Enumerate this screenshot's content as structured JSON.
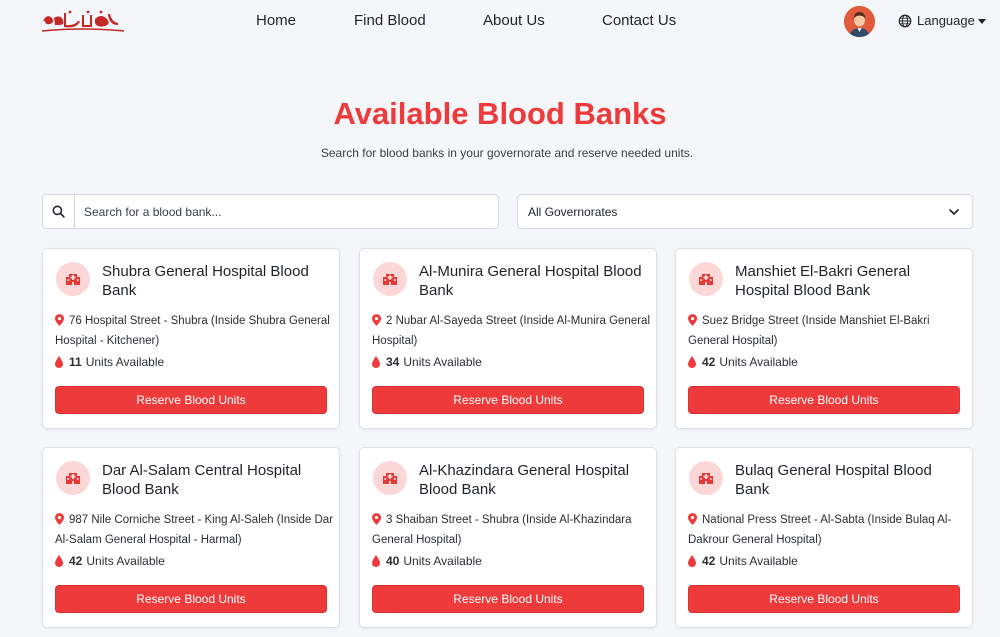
{
  "nav": {
    "links": [
      "Home",
      "Find Blood",
      "About Us",
      "Contact Us"
    ],
    "language_label": "Language"
  },
  "header": {
    "title": "Available Blood Banks",
    "subtitle": "Search for blood banks in your governorate and reserve needed units."
  },
  "search": {
    "placeholder": "Search for a blood bank...",
    "governorate_selected": "All Governorates"
  },
  "cards": [
    {
      "name": "Shubra General Hospital Blood Bank",
      "address": "76 Hospital Street - Shubra (Inside Shubra General Hospital - Kitchener)",
      "units": "11",
      "units_label": "Units Available",
      "button": "Reserve Blood Units"
    },
    {
      "name": "Al-Munira General Hospital Blood Bank",
      "address": "2 Nubar Al-Sayeda Street (Inside Al-Munira General Hospital)",
      "units": "34",
      "units_label": "Units Available",
      "button": "Reserve Blood Units"
    },
    {
      "name": "Manshiet El-Bakri General Hospital Blood Bank",
      "address": "Suez Bridge Street (Inside Manshiet El-Bakri General Hospital)",
      "units": "42",
      "units_label": "Units Available",
      "button": "Reserve Blood Units"
    },
    {
      "name": "Dar Al-Salam Central Hospital Blood Bank",
      "address": "987 Nile Corniche Street - King Al-Saleh (Inside Dar Al-Salam General Hospital - Harmal)",
      "units": "42",
      "units_label": "Units Available",
      "button": "Reserve Blood Units"
    },
    {
      "name": "Al-Khazindara General Hospital Blood Bank",
      "address": "3 Shaiban Street - Shubra (Inside Al-Khazindara General Hospital)",
      "units": "40",
      "units_label": "Units Available",
      "button": "Reserve Blood Units"
    },
    {
      "name": "Bulaq General Hospital Blood Bank",
      "address": "National Press Street - Al-Sabta (Inside Bulaq Al-Dakrour General Hospital)",
      "units": "42",
      "units_label": "Units Available",
      "button": "Reserve Blood Units"
    }
  ],
  "colors": {
    "accent": "#ee3a3a",
    "icon_bg": "#fbd7d7",
    "page_bg": "#f4f6f9"
  },
  "icons": {
    "logo": "arabic-calligraphy-logo",
    "search": "search-icon",
    "language": "globe-icon",
    "location": "map-pin-icon",
    "units": "blood-drop-icon",
    "bank": "hospital-icon",
    "select": "chevron-down-icon"
  }
}
